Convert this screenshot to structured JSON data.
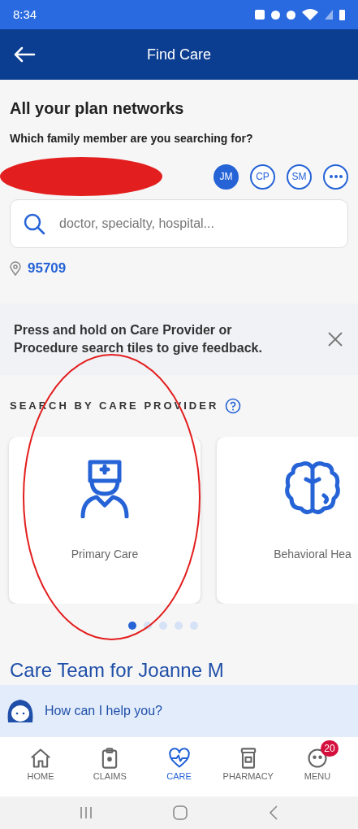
{
  "status_bar": {
    "time": "8:34"
  },
  "header": {
    "title": "Find Care"
  },
  "plan": {
    "title": "All your plan networks",
    "question": "Which family member are you searching for?"
  },
  "members": [
    {
      "initials": "JM",
      "selected": true
    },
    {
      "initials": "CP",
      "selected": false
    },
    {
      "initials": "SM",
      "selected": false
    }
  ],
  "search": {
    "placeholder": "doctor, specialty, hospital..."
  },
  "location": {
    "zip": "95709"
  },
  "feedback_banner": {
    "text": "Press and hold on Care Provider or Procedure search tiles to give feedback."
  },
  "section": {
    "title": "SEARCH BY CARE PROVIDER"
  },
  "tiles": [
    {
      "kind": "nurse",
      "label": "Primary Care"
    },
    {
      "kind": "brain",
      "label": "Behavioral Hea"
    }
  ],
  "carousel_dots": [
    {
      "selected": true
    },
    {
      "selected": false
    },
    {
      "selected": false
    },
    {
      "selected": false
    },
    {
      "selected": false
    }
  ],
  "care_team": {
    "title": "Care Team for Joanne M"
  },
  "chat": {
    "prompt": "How can I help you?"
  },
  "bottom_nav": [
    {
      "kind": "home",
      "label": "HOME",
      "selected": false
    },
    {
      "kind": "claims",
      "label": "CLAIMS",
      "selected": false
    },
    {
      "kind": "care",
      "label": "CARE",
      "selected": true
    },
    {
      "kind": "pharmacy",
      "label": "PHARMACY",
      "selected": false
    },
    {
      "kind": "menu",
      "label": "MENU",
      "selected": false,
      "badge": "20"
    }
  ]
}
